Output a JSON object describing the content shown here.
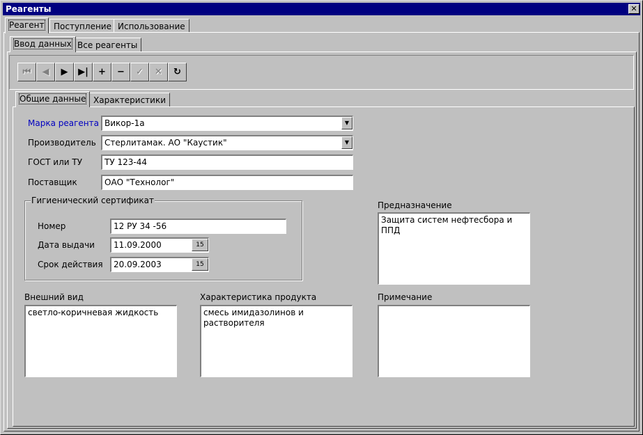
{
  "window": {
    "title": "Реагенты",
    "close_glyph": "✕"
  },
  "main_tabs": [
    "Реагент",
    "Поступление",
    "Использование"
  ],
  "sub_tabs": [
    "Ввод данных",
    "Все реагенты"
  ],
  "navigator": {
    "buttons": [
      {
        "icon": "first-record-icon",
        "glyph": "⏮",
        "enabled": false
      },
      {
        "icon": "prior-record-icon",
        "glyph": "◀",
        "enabled": false
      },
      {
        "icon": "next-record-icon",
        "glyph": "▶",
        "enabled": true
      },
      {
        "icon": "last-record-icon",
        "glyph": "▶|",
        "enabled": true
      },
      {
        "icon": "insert-record-icon",
        "glyph": "+",
        "enabled": true
      },
      {
        "icon": "delete-record-icon",
        "glyph": "−",
        "enabled": true
      },
      {
        "icon": "post-record-icon",
        "glyph": "✓",
        "enabled": false
      },
      {
        "icon": "cancel-edit-icon",
        "glyph": "✕",
        "enabled": false
      },
      {
        "icon": "refresh-icon",
        "glyph": "↻",
        "enabled": true
      }
    ]
  },
  "detail_tabs": [
    "Общие данные",
    "Характеристики"
  ],
  "form": {
    "brand_label": "Марка реагента",
    "brand_value": "Викор-1а",
    "manufacturer_label": "Производитель",
    "manufacturer_value": "Стерлитамак. АО \"Каустик\"",
    "gost_label": "ГОСТ или ТУ",
    "gost_value": "ТУ 123-44",
    "supplier_label": "Поставщик",
    "supplier_value": "ОАО \"Технолог\""
  },
  "certificate": {
    "title": "Гигиенический сертификат",
    "number_label": "Номер",
    "number_value": "12 РУ 34 -56",
    "issue_label": "Дата выдачи",
    "issue_value": "11.09.2000",
    "validity_label": "Срок действия",
    "validity_value": "20.09.2003",
    "calendar_glyph": "15"
  },
  "purpose": {
    "label": "Предназначение",
    "value": "Защита систем нефтесбора и\nППД"
  },
  "appearance": {
    "label": "Внешний вид",
    "value": "светло-коричневая жидкость"
  },
  "characteristic": {
    "label": "Характеристика продукта",
    "value": "смесь имидазолинов и\nрастворителя"
  },
  "note": {
    "label": "Примечание",
    "value": ""
  },
  "colors": {
    "title_bar": "#000080",
    "required_label": "#0000c0",
    "face": "#c0c0c0"
  }
}
